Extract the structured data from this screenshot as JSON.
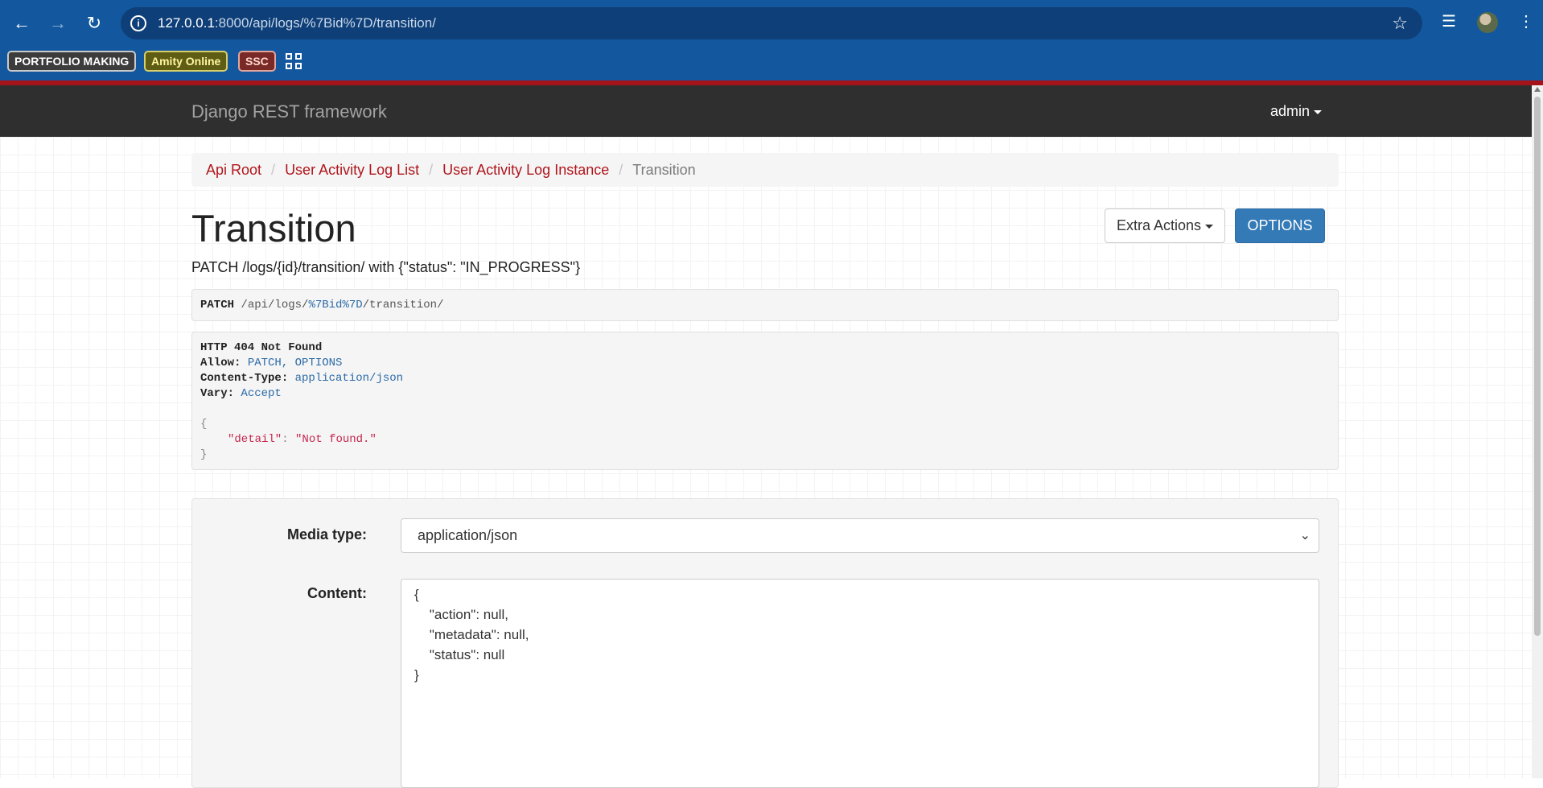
{
  "browser": {
    "url_host": "127.0.0.1",
    "url_rest": ":8000/api/logs/%7Bid%7D/transition/",
    "bookmarks": [
      "PORTFOLIO MAKING",
      "Amity Online",
      "SSC"
    ]
  },
  "navbar": {
    "brand": "Django REST framework",
    "user": "admin"
  },
  "breadcrumb": [
    "Api Root",
    "User Activity Log List",
    "User Activity Log Instance",
    "Transition"
  ],
  "page": {
    "title": "Transition",
    "extra_actions": "Extra Actions",
    "options": "OPTIONS",
    "description": "PATCH /logs/{id}/transition/ with {\"status\": \"IN_PROGRESS\"}"
  },
  "request": {
    "method": "PATCH",
    "path_a": " /api/logs/",
    "path_enc1": "%7Bid%7D",
    "path_b": "/transition/"
  },
  "response": {
    "status": "HTTP 404 Not Found",
    "headers": [
      {
        "key": "Allow:",
        "value": "PATCH, OPTIONS"
      },
      {
        "key": "Content-Type:",
        "value": "application/json"
      },
      {
        "key": "Vary:",
        "value": "Accept"
      }
    ],
    "open_brace": "{",
    "body_key": "\"detail\"",
    "body_colon": ": ",
    "body_value": "\"Not found.\"",
    "close_brace": "}"
  },
  "form": {
    "media_type_label": "Media type:",
    "media_type_value": "application/json",
    "content_label": "Content:",
    "content_value": "{\n    \"action\": null,\n    \"metadata\": null,\n    \"status\": null\n}"
  }
}
